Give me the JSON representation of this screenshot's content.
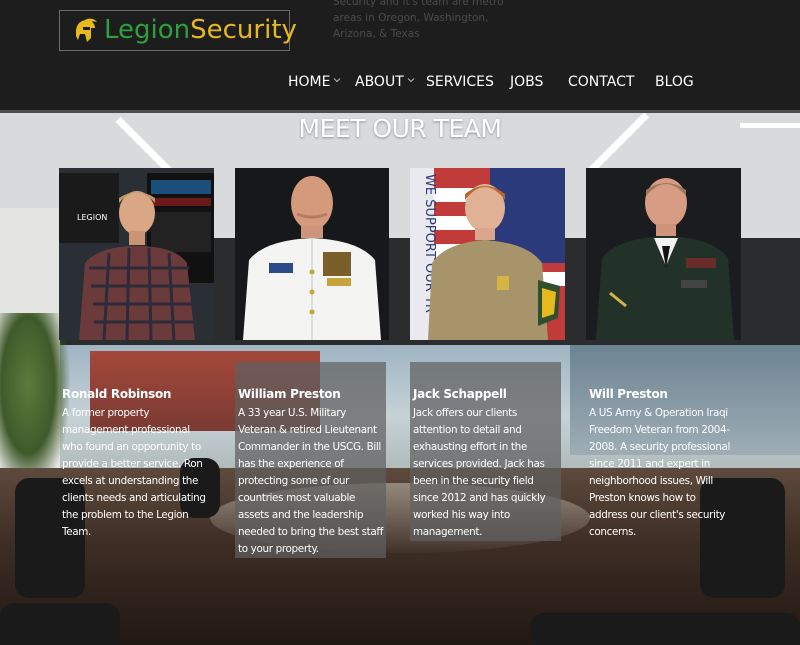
{
  "brand": {
    "name_part1": "Legion",
    "name_part2": "Security",
    "accent_green": "#2e9e3f",
    "accent_gold": "#e6b91c",
    "tagline": "Security and it's team are metro areas in Oregon, Washington, Arizona, & Texas"
  },
  "nav": {
    "items": [
      {
        "label": "HOME",
        "has_dropdown": true
      },
      {
        "label": "ABOUT",
        "has_dropdown": true
      },
      {
        "label": "SERVICES",
        "has_dropdown": false
      },
      {
        "label": "JOBS",
        "has_dropdown": false
      },
      {
        "label": "CONTACT",
        "has_dropdown": false
      },
      {
        "label": "BLOG",
        "has_dropdown": false
      }
    ]
  },
  "page": {
    "title": "MEET OUR TEAM"
  },
  "team": [
    {
      "name": "Ronald Robinson",
      "bio": "A former property management professional who found an opportunity to provide a better service. Ron excels at understanding the clients needs and articulating the problem to the Legion Team."
    },
    {
      "name": "William Preston",
      "bio": "A 33 year U.S. Military Veteran & retired Lieutenant Commander in the USCG. Bill has the experience of protecting some of our countries most valuable assets and the leadership needed to bring the best staff to your property."
    },
    {
      "name": "Jack Schappell",
      "bio": "Jack offers our clients attention to detail and exhausting effort in the services provided. Jack has been in the security field since 2012 and has quickly worked his way into management."
    },
    {
      "name": "Will Preston",
      "bio": "A US Army & Operation Iraqi Freedom Veteran from 2004-2008. A security professional since 2011 and expert in neighborhood issues, Will Preston knows how to address our client's security concerns."
    }
  ],
  "photo_text": {
    "banner": "WE SUPPORT OUR TR",
    "screen_logo": "LEGION"
  }
}
